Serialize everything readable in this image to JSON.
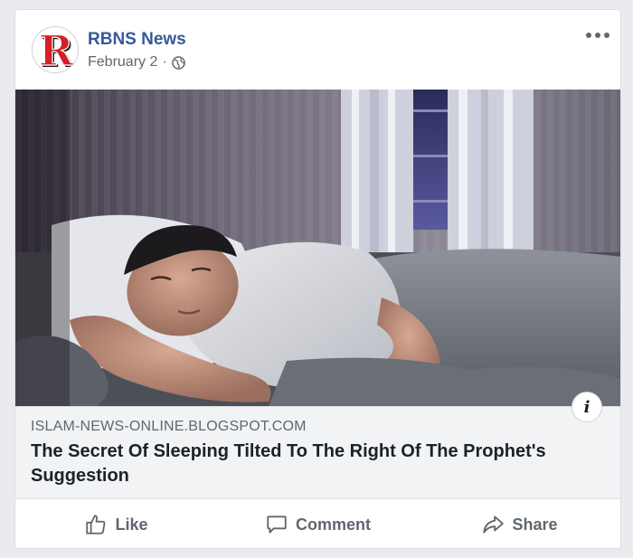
{
  "post": {
    "page_name": "RBNS News",
    "date": "February 2",
    "separator": "·",
    "avatar_letter": "R",
    "privacy_icon": "globe-icon",
    "more_icon": "ellipsis-icon"
  },
  "link": {
    "domain": "ISLAM-NEWS-ONLINE.BLOGSPOT.COM",
    "headline": "The Secret Of Sleeping Tilted To The Right Of The Prophet's Suggestion",
    "info_label": "i"
  },
  "actions": {
    "like_label": "Like",
    "comment_label": "Comment",
    "share_label": "Share"
  },
  "colors": {
    "page_name": "#385898",
    "muted": "#606770",
    "link_bg": "#f2f3f5",
    "avatar_red": "#d61f26"
  }
}
